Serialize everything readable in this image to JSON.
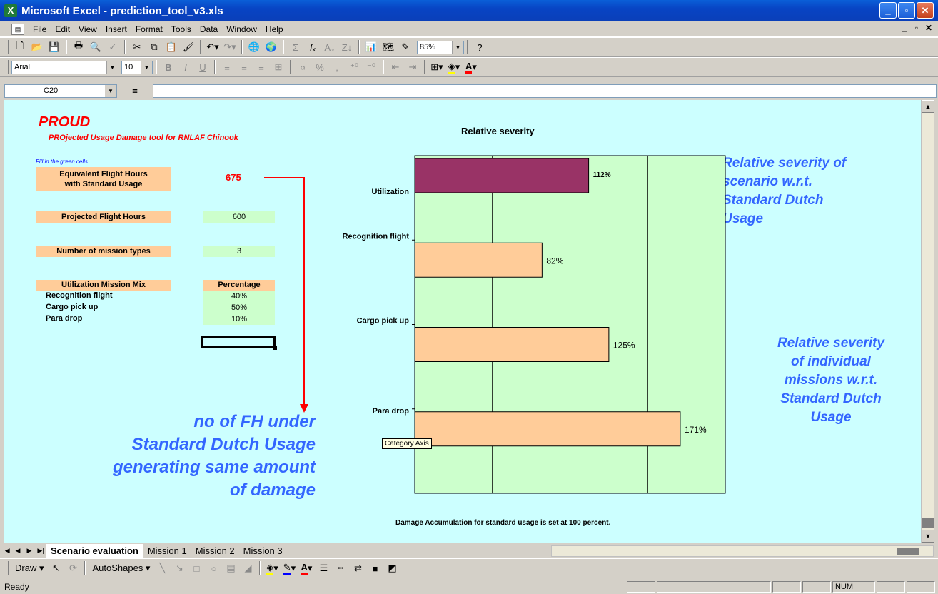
{
  "window": {
    "title": "Microsoft Excel - prediction_tool_v3.xls",
    "app_icon": "X"
  },
  "window_buttons": {
    "minimize": "_",
    "maximize": "▫",
    "close": "✕"
  },
  "menubar": {
    "items": [
      "File",
      "Edit",
      "View",
      "Insert",
      "Format",
      "Tools",
      "Data",
      "Window",
      "Help"
    ],
    "right_controls": [
      "_",
      "▫",
      "✕"
    ]
  },
  "toolbar": {
    "zoom": "85%",
    "help": "?"
  },
  "format_toolbar": {
    "font": "Arial",
    "size": "10",
    "bold": "B",
    "italic": "I",
    "underline": "U",
    "percent": "%",
    "comma": ","
  },
  "formula_bar": {
    "cell_ref": "C20",
    "equals": "=",
    "formula": ""
  },
  "sheet": {
    "title": "PROUD",
    "subtitle": "PROjected Usage Damage tool for RNLAF Chinook",
    "fill_note": "Fill in the green cells",
    "efh_label_line1": "Equivalent Flight Hours",
    "efh_label_line2": "with Standard Usage",
    "efh_value": "675",
    "projected_label": "Projected Flight Hours",
    "projected_value": "600",
    "mission_types_label": "Number of mission types",
    "mission_types_value": "3",
    "mix_header": "Utilization Mission Mix",
    "pct_header": "Percentage",
    "mix_rows": [
      {
        "name": "Recognition flight",
        "pct": "40%"
      },
      {
        "name": "Cargo pick up",
        "pct": "50%"
      },
      {
        "name": "Para drop",
        "pct": "10%"
      }
    ],
    "annotation_left": [
      "no of FH under",
      "Standard Dutch Usage",
      "generating same amount",
      "of damage"
    ],
    "annotation_right_top": [
      "Relative severity of",
      "scenario w.r.t.",
      "Standard Dutch",
      "Usage"
    ],
    "annotation_right_bottom": [
      "Relative severity",
      "of individual",
      "missions w.r.t.",
      "Standard Dutch",
      "Usage"
    ],
    "chart_footnote": "Damage Accumulation for standard usage is set at 100 percent.",
    "tooltip": "Category Axis"
  },
  "chart_data": {
    "type": "bar",
    "orientation": "horizontal",
    "title": "Relative severity",
    "categories": [
      "Utilization",
      "Recognition flight",
      "Cargo pick up",
      "Para drop"
    ],
    "values": [
      112,
      82,
      125,
      171
    ],
    "value_labels": [
      "112%",
      "82%",
      "125%",
      "171%"
    ],
    "unit": "percent",
    "xlim": [
      0,
      200
    ],
    "gridlines": [
      50,
      100,
      150
    ],
    "grid": true,
    "colors": {
      "Utilization": "#993366",
      "missions": "#ffcc99",
      "plot_area": "#ccffcc"
    }
  },
  "sheet_tabs": {
    "tabs": [
      "Scenario evaluation",
      "Mission 1",
      "Mission 2",
      "Mission 3"
    ],
    "active": "Scenario evaluation"
  },
  "drawing_toolbar": {
    "draw": "Draw ▾",
    "autoshapes": "AutoShapes ▾"
  },
  "status": {
    "ready": "Ready",
    "num": "NUM"
  },
  "colors": {
    "sheet_bg": "#ccffff",
    "input_cell": "#ccffcc",
    "label_cell": "#ffcc99",
    "accent_red": "#ff0000",
    "annotation_blue": "#3366ff"
  }
}
